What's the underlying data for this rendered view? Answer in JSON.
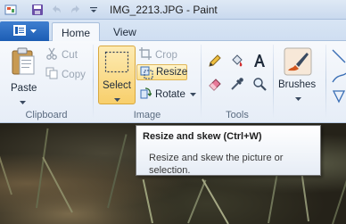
{
  "window": {
    "title": "IMG_2213.JPG - Paint"
  },
  "tabs": [
    {
      "label": "Home",
      "active": true
    },
    {
      "label": "View",
      "active": false
    }
  ],
  "groups": {
    "clipboard": {
      "label": "Clipboard",
      "paste": "Paste",
      "cut": "Cut",
      "copy": "Copy"
    },
    "image": {
      "label": "Image",
      "select": "Select",
      "crop": "Crop",
      "resize": "Resize",
      "rotate": "Rotate"
    },
    "tools": {
      "label": "Tools"
    },
    "brushes": {
      "label": "Brushes"
    }
  },
  "tooltip": {
    "title": "Resize and skew (Ctrl+W)",
    "description": "Resize and skew the picture or selection."
  },
  "colors": {
    "accent": "#1c5db4",
    "highlight": "#f8cf6c"
  },
  "icons": [
    "save-icon",
    "undo-icon",
    "redo-icon",
    "customize-icon",
    "paste-icon",
    "cut-icon",
    "copy-icon",
    "select-icon",
    "crop-icon",
    "resize-icon",
    "rotate-icon",
    "pencil-icon",
    "fill-icon",
    "text-icon",
    "eraser-icon",
    "color-picker-icon",
    "magnifier-icon",
    "brushes-icon",
    "shapes-icon"
  ]
}
